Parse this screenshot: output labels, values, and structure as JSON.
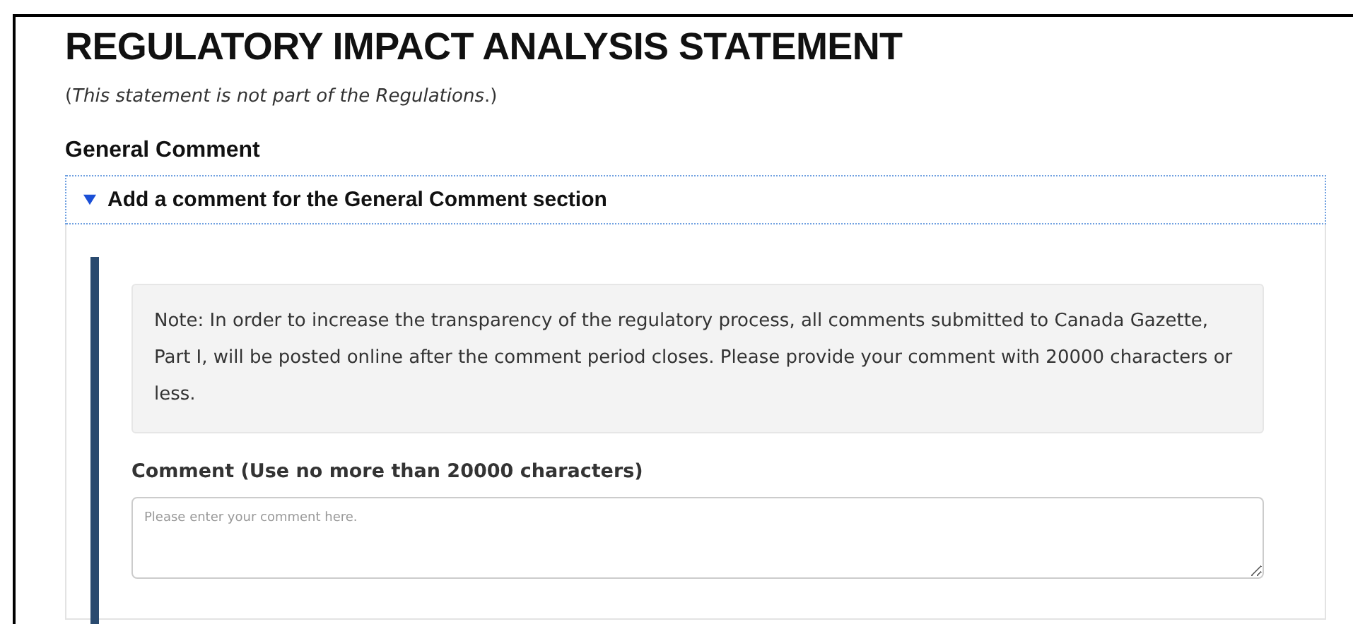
{
  "heading": "REGULATORY IMPACT ANALYSIS STATEMENT",
  "subtitle": "(*This statement is not part of the Regulations*.)",
  "section_title": "General Comment",
  "disclosure": {
    "label": "Add a comment for the General Comment section",
    "expanded": true
  },
  "note": "Note: In order to increase the transparency of the regulatory process, all comments submitted to Canada Gazette, Part I, will be posted online after the comment period closes. Please provide your comment with 20000 characters or less.",
  "comment_field": {
    "label": "Comment (Use no more than 20000 characters)",
    "placeholder": "Please enter your comment here."
  }
}
